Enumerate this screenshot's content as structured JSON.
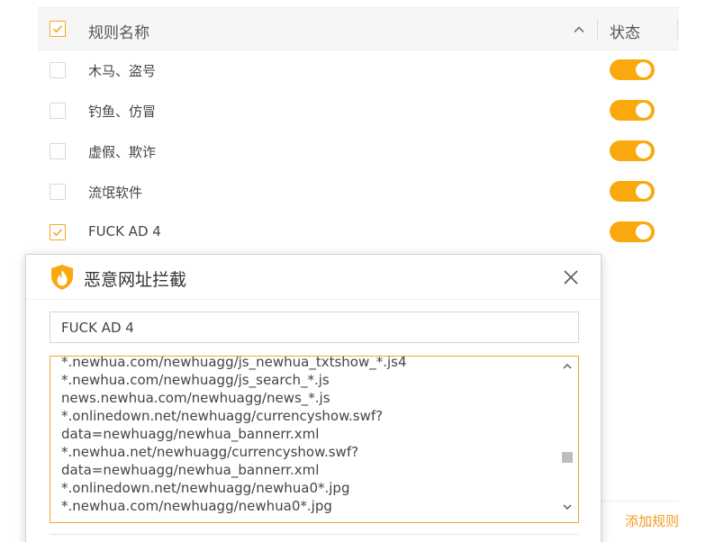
{
  "table": {
    "header": {
      "name": "规则名称",
      "status": "状态"
    },
    "rows": [
      {
        "name": "木马、盗号",
        "checked": false,
        "enabled": true
      },
      {
        "name": "钓鱼、仿冒",
        "checked": false,
        "enabled": true
      },
      {
        "name": "虚假、欺诈",
        "checked": false,
        "enabled": true
      },
      {
        "name": "流氓软件",
        "checked": false,
        "enabled": true
      },
      {
        "name": "FUCK AD 4",
        "checked": true,
        "enabled": true
      }
    ],
    "add_rule": "添加规则"
  },
  "dialog": {
    "title": "恶意网址拦截",
    "name_value": "FUCK AD 4",
    "url_lines": [
      "*.newhua.com/newhuagg/js_newhua_txtshow_*.js4",
      "*.newhua.com/newhuagg/js_search_*.js",
      "news.newhua.com/newhuagg/news_*.js",
      "*.onlinedown.net/newhuagg/currencyshow.swf?",
      "data=newhuagg/newhua_bannerr.xml",
      "*.newhua.net/newhuagg/currencyshow.swf?",
      "data=newhuagg/newhua_bannerr.xml",
      "*.onlinedown.net/newhuagg/newhua0*.jpg",
      "*.newhua.com/newhuagg/newhua0*.jpg"
    ]
  },
  "colors": {
    "accent": "#f9a90e",
    "accent_text": "#f29b1b",
    "checkbox_checked": "#f5a623"
  },
  "icons": [
    "checkmark-icon",
    "chevron-up-icon",
    "shield-flame-icon",
    "close-icon",
    "scroll-up-icon",
    "scroll-down-icon"
  ]
}
